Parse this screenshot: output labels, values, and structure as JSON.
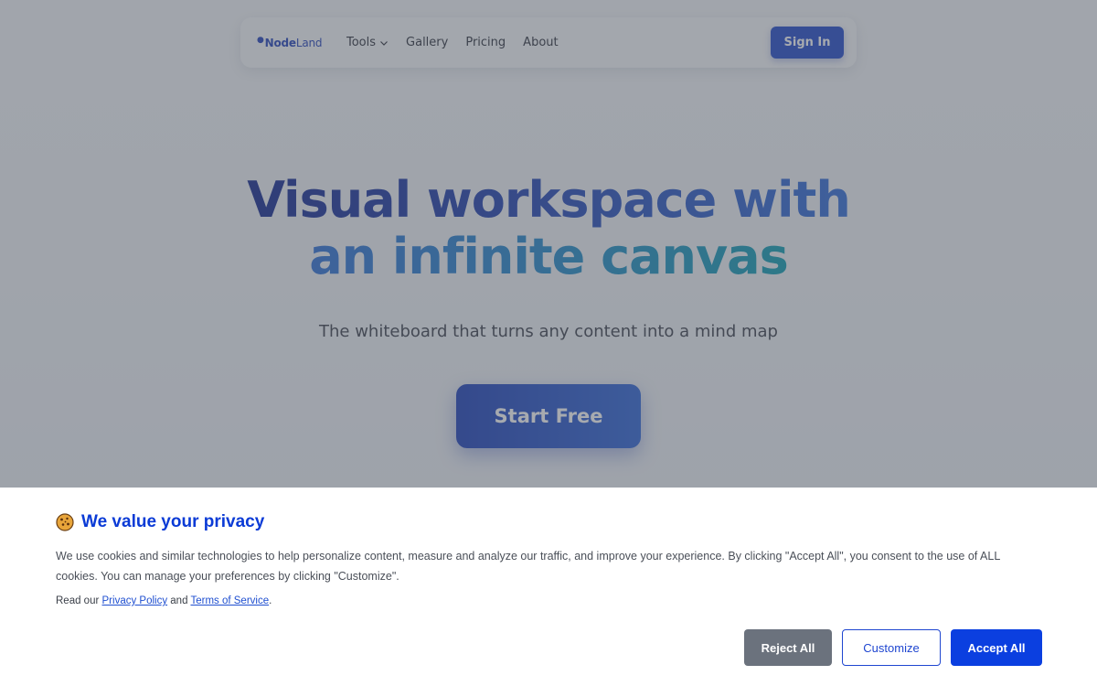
{
  "nav": {
    "logo_bold": "Node",
    "logo_light": "Land",
    "links": [
      "Tools",
      "Gallery",
      "Pricing",
      "About"
    ],
    "signin_label": "Sign In"
  },
  "hero": {
    "title_line1": "Visual workspace with",
    "title_line2": "an infinite canvas",
    "subtitle": "The whiteboard that turns any content into a mind map",
    "cta_label": "Start Free"
  },
  "cookie_banner": {
    "icon": "cookie-icon",
    "title": "We value your privacy",
    "text": "We use cookies and similar technologies to help personalize content, measure and analyze our traffic, and improve your experience. By clicking \"Accept All\", you consent to the use of ALL cookies. You can manage your preferences by clicking \"Customize\".",
    "read_prefix": "Read our ",
    "privacy_link": "Privacy Policy",
    "read_and": " and ",
    "terms_link": "Terms of Service",
    "read_suffix": ".",
    "reject_label": "Reject All",
    "customize_label": "Customize",
    "accept_label": "Accept All"
  },
  "colors": {
    "brand": "#1e47c9",
    "accept": "#0b3fe0",
    "reject": "#6b727d",
    "banner_title": "#0b3bd6"
  }
}
